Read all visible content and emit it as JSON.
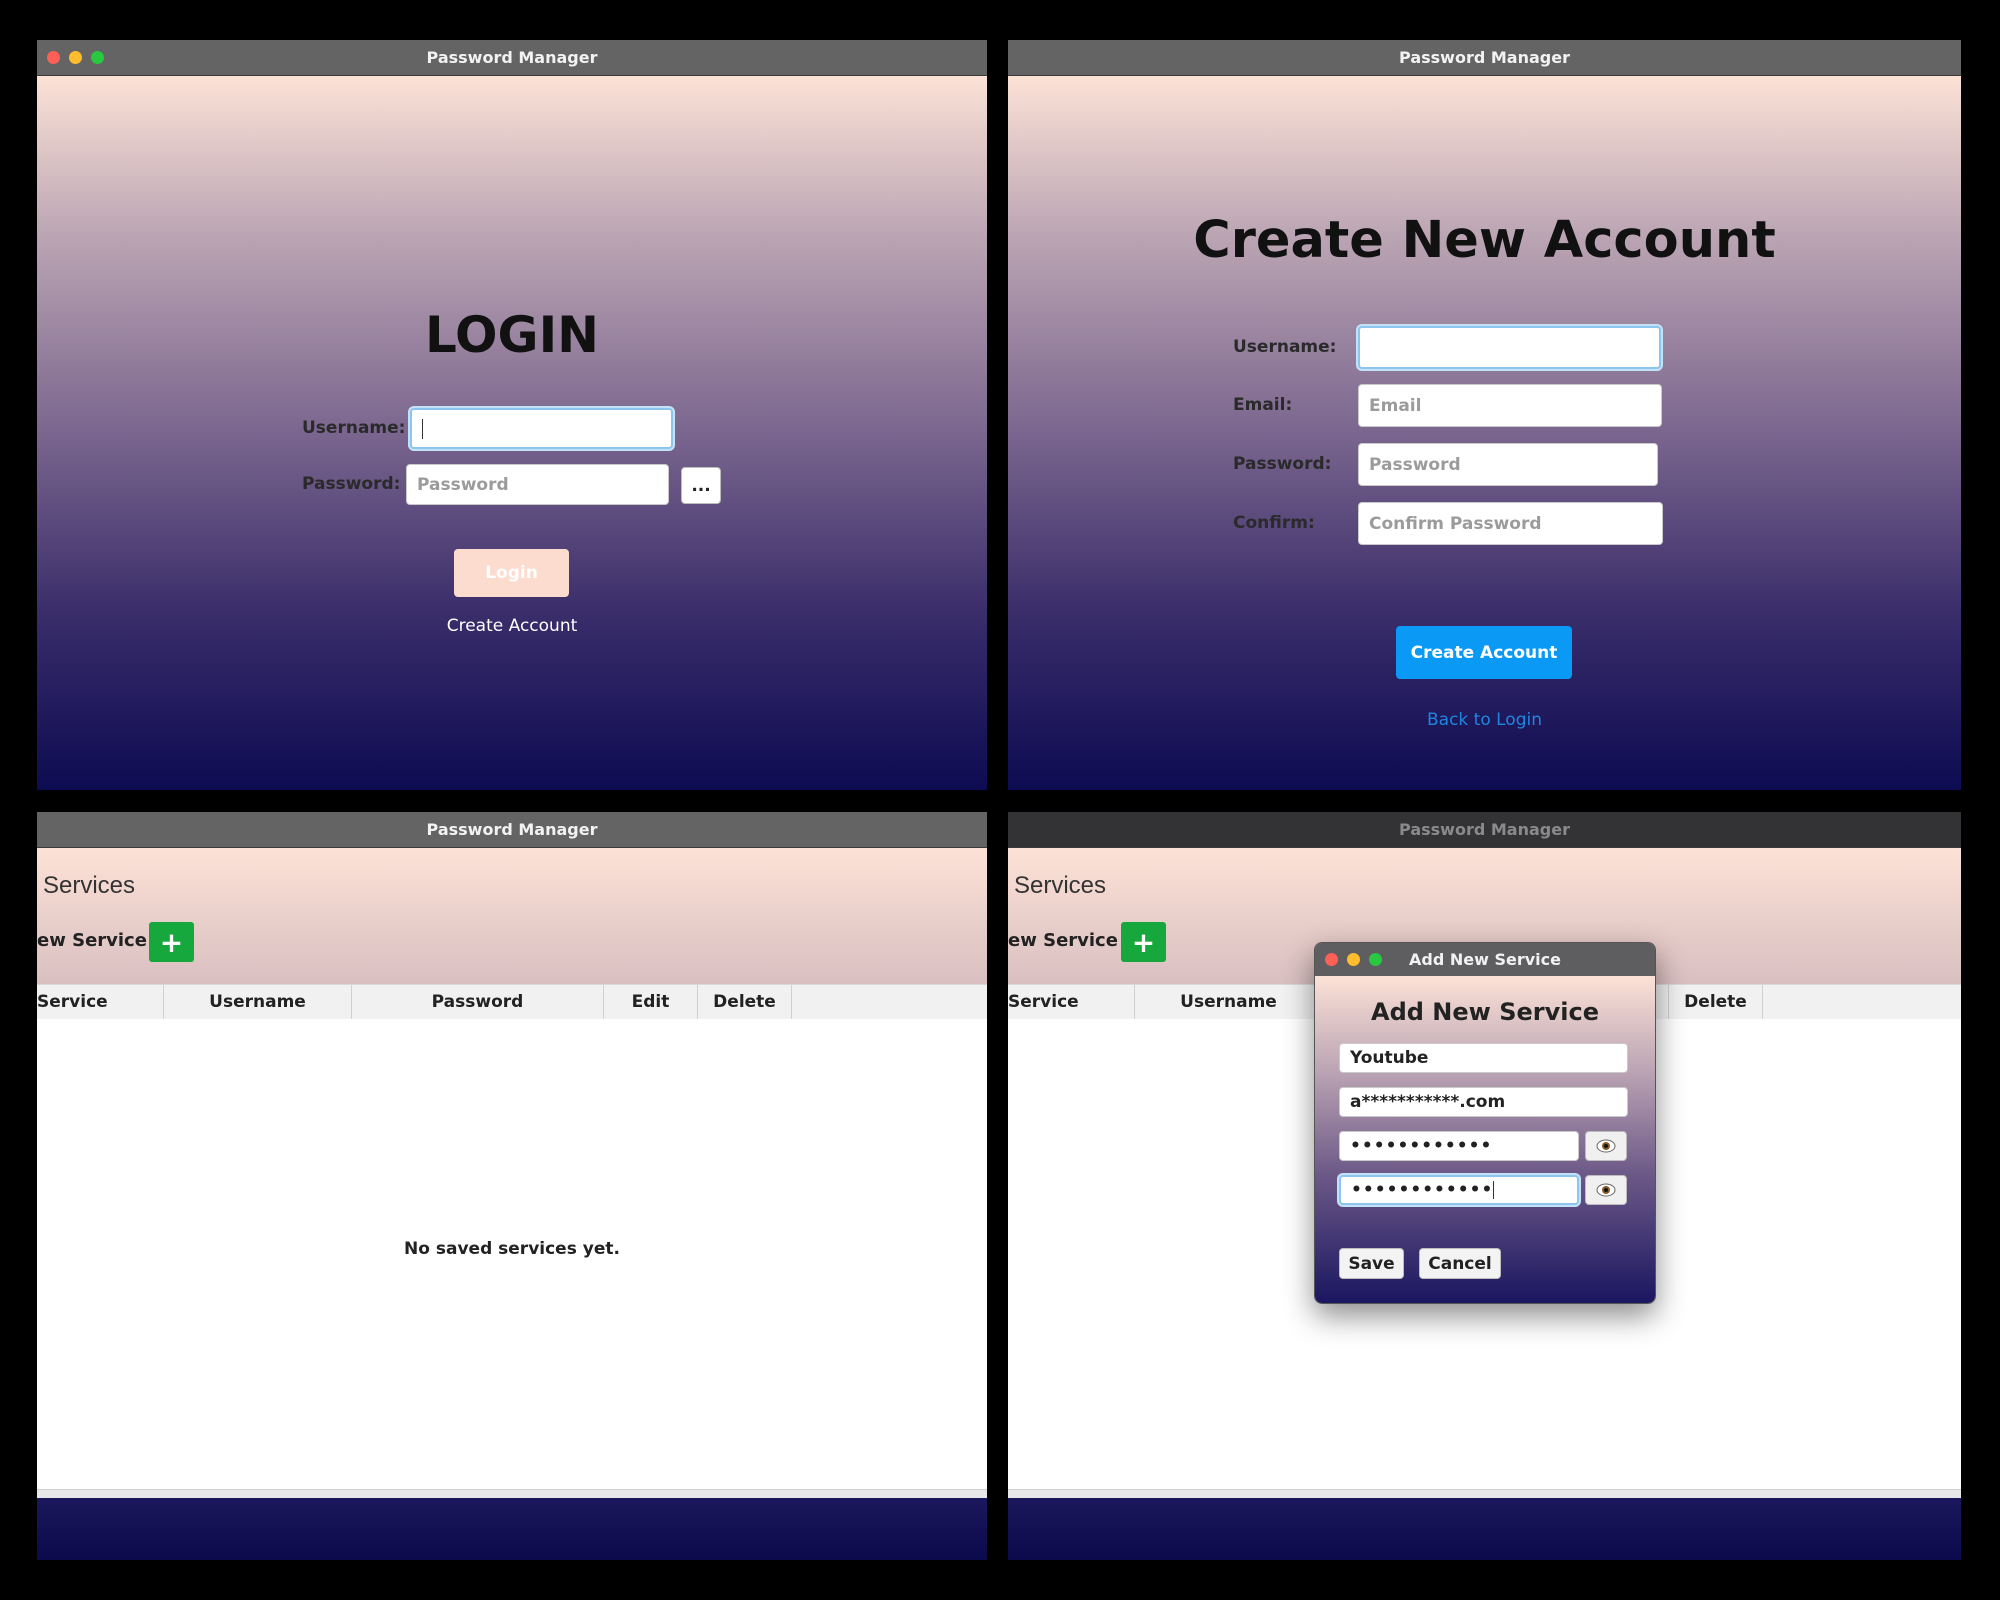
{
  "app_title": "Password Manager",
  "login": {
    "heading": "LOGIN",
    "username_label": "Username:",
    "password_label": "Password:",
    "password_placeholder": "Password",
    "reveal_label": "...",
    "login_button": "Login",
    "create_account_link": "Create Account"
  },
  "create": {
    "heading": "Create New Account",
    "username_label": "Username:",
    "email_label": "Email:",
    "email_placeholder": "Email",
    "password_label": "Password:",
    "password_placeholder": "Password",
    "confirm_label": "Confirm:",
    "confirm_placeholder": "Confirm Password",
    "create_button": "Create Account",
    "back_link": "Back to Login"
  },
  "services": {
    "title_partial": "l Services",
    "add_label_partial": "ew Service",
    "add_icon": "plus-icon",
    "columns": [
      "Service",
      "Username",
      "Password",
      "Edit",
      "Delete"
    ],
    "empty_message": "No saved services yet."
  },
  "dialog": {
    "window_title": "Add New Service",
    "heading": "Add New Service",
    "service_value": "Youtube",
    "username_value": "a***********.com",
    "password_value": "••••••••••••",
    "confirm_value": "••••••••••••",
    "eye_icon": "eye-icon",
    "save_button": "Save",
    "cancel_button": "Cancel"
  },
  "colors": {
    "primary_blue": "#0a9af5",
    "link_blue": "#1f86e0",
    "add_green": "#16a83d",
    "login_button_bg": "#fcdccf"
  }
}
